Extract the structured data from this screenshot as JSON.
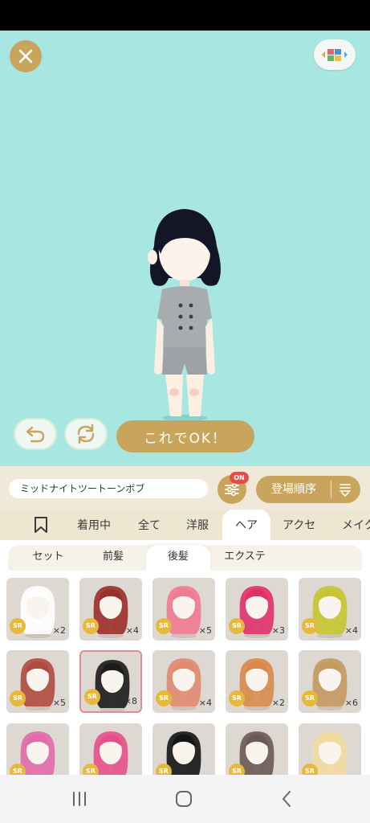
{
  "stage": {
    "ok_label": "これでOK！"
  },
  "namebar": {
    "item_name": "ミッドナイトツートーンボブ",
    "filter_badge": "ON",
    "sort_label": "登場順序"
  },
  "main_tabs": [
    {
      "label": "着用中"
    },
    {
      "label": "全て"
    },
    {
      "label": "洋服"
    },
    {
      "label": "ヘア",
      "active": true
    },
    {
      "label": "アクセ"
    },
    {
      "label": "メイク"
    }
  ],
  "sub_tabs": [
    {
      "label": "セット"
    },
    {
      "label": "前髪"
    },
    {
      "label": "後髪",
      "active": true
    },
    {
      "label": "エクステ"
    }
  ],
  "items": [
    {
      "rarity": "SR",
      "count": "×2",
      "hair_color": "#ffffff"
    },
    {
      "rarity": "SR",
      "count": "×4",
      "hair_color": "#9b2f2a"
    },
    {
      "rarity": "SR",
      "count": "×5",
      "hair_color": "#f07a90"
    },
    {
      "rarity": "SR",
      "count": "×3",
      "hair_color": "#e0306a"
    },
    {
      "rarity": "SR",
      "count": "×4",
      "hair_color": "#c7c530"
    },
    {
      "rarity": "SR",
      "count": "×5",
      "hair_color": "#b04a3e"
    },
    {
      "rarity": "SR",
      "count": "×8",
      "hair_color": "#1c1c1c",
      "selected": true
    },
    {
      "rarity": "SR",
      "count": "×4",
      "hair_color": "#e08a70"
    },
    {
      "rarity": "SR",
      "count": "×2",
      "hair_color": "#d98a4a"
    },
    {
      "rarity": "SR",
      "count": "×6",
      "hair_color": "#c39a60"
    },
    {
      "rarity": "SR",
      "count": "",
      "hair_color": "#e26aa8"
    },
    {
      "rarity": "SR",
      "count": "",
      "hair_color": "#e6508a"
    },
    {
      "rarity": "SR",
      "count": "",
      "hair_color": "#151515"
    },
    {
      "rarity": "SR",
      "count": "",
      "hair_color": "#6a5a55"
    },
    {
      "rarity": "SR",
      "count": "",
      "hair_color": "#f0dca0"
    }
  ],
  "colors": {
    "stage_bg": "#a8e6e2",
    "accent_gold": "#c9a45c",
    "badge_red": "#e94b4b",
    "rarity_gold": "#e8b83a",
    "selected_border": "#e58a95"
  },
  "icons": {
    "close": "close-icon",
    "view_toggle": "color-blocks-icon",
    "undo": "undo-icon",
    "randomize": "rotate-icon",
    "filter": "sliders-icon",
    "sort": "sort-lines-icon",
    "bookmark": "bookmark-icon"
  }
}
